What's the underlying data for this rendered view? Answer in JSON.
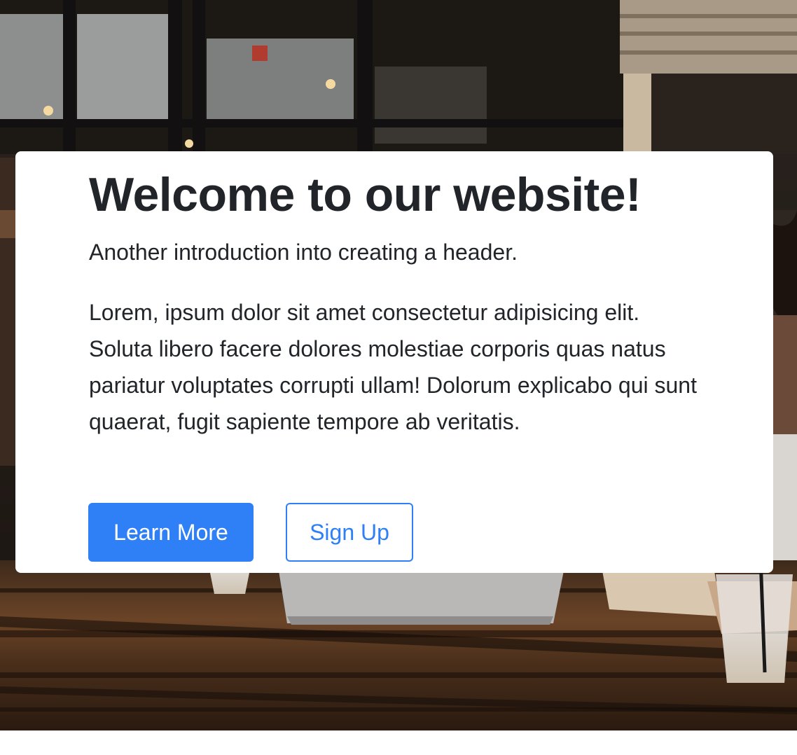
{
  "hero": {
    "title": "Welcome to our website!",
    "lead": "Another introduction into creating a header.",
    "body": "Lorem, ipsum dolor sit amet consectetur adipisicing elit. Soluta libero facere dolores molestiae corporis quas natus pariatur voluptates corrupti ullam! Dolorum explicabo qui sunt quaerat, fugit sapiente tempore ab veritatis.",
    "buttons": {
      "primary_label": "Learn More",
      "secondary_label": "Sign Up"
    }
  },
  "colors": {
    "accent": "#2f80f6",
    "text": "#212529",
    "card_bg": "#ffffff"
  }
}
